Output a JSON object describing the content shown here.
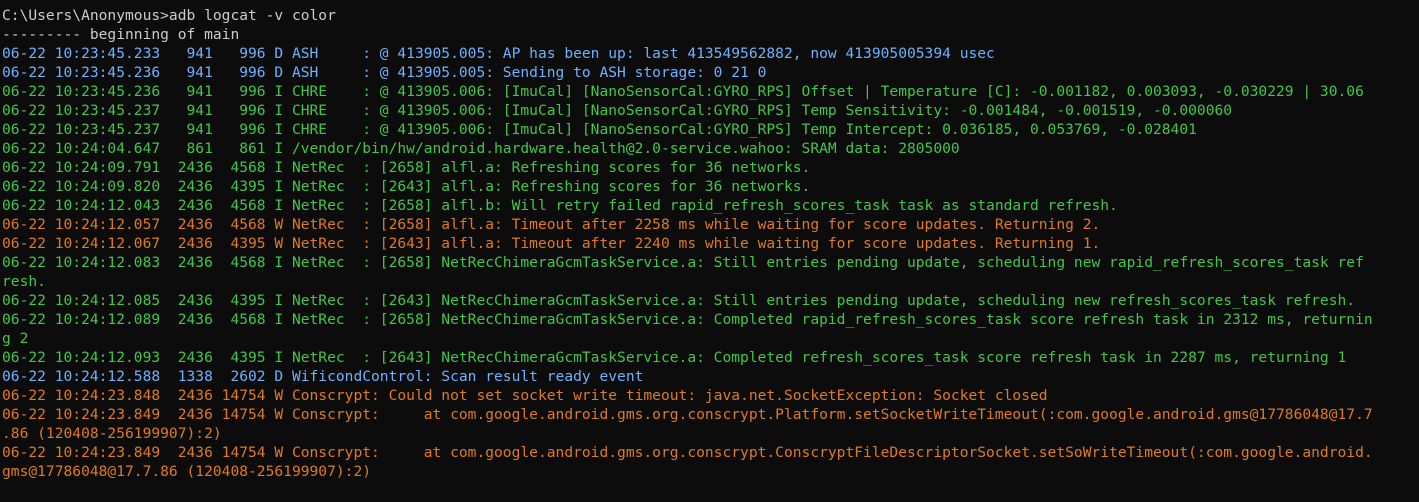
{
  "terminal": {
    "colors": {
      "background": "#0c0c0c",
      "default": "#cccccc",
      "debug": "#6fb1ff",
      "info": "#41c748",
      "warn": "#e07a1f"
    },
    "lines": [
      {
        "level": "default",
        "text": "C:\\Users\\Anonymous>adb logcat -v color"
      },
      {
        "level": "default",
        "text": "--------- beginning of main"
      },
      {
        "level": "D",
        "text": "06-22 10:23:45.233   941   996 D ASH     : @ 413905.005: AP has been up: last 413549562882, now 413905005394 usec"
      },
      {
        "level": "D",
        "text": "06-22 10:23:45.236   941   996 D ASH     : @ 413905.005: Sending to ASH storage: 0 21 0"
      },
      {
        "level": "I",
        "text": "06-22 10:23:45.236   941   996 I CHRE    : @ 413905.006: [ImuCal] [NanoSensorCal:GYRO_RPS] Offset | Temperature [C]: -0.001182, 0.003093, -0.030229 | 30.06"
      },
      {
        "level": "I",
        "text": "06-22 10:23:45.237   941   996 I CHRE    : @ 413905.006: [ImuCal] [NanoSensorCal:GYRO_RPS] Temp Sensitivity: -0.001484, -0.001519, -0.000060"
      },
      {
        "level": "I",
        "text": "06-22 10:23:45.237   941   996 I CHRE    : @ 413905.006: [ImuCal] [NanoSensorCal:GYRO_RPS] Temp Intercept: 0.036185, 0.053769, -0.028401"
      },
      {
        "level": "I",
        "text": "06-22 10:24:04.647   861   861 I /vendor/bin/hw/android.hardware.health@2.0-service.wahoo: SRAM data: 2805000"
      },
      {
        "level": "I",
        "text": "06-22 10:24:09.791  2436  4568 I NetRec  : [2658] alfl.a: Refreshing scores for 36 networks."
      },
      {
        "level": "I",
        "text": "06-22 10:24:09.820  2436  4395 I NetRec  : [2643] alfl.a: Refreshing scores for 36 networks."
      },
      {
        "level": "I",
        "text": "06-22 10:24:12.043  2436  4568 I NetRec  : [2658] alfl.b: Will retry failed rapid_refresh_scores_task task as standard refresh."
      },
      {
        "level": "W",
        "text": "06-22 10:24:12.057  2436  4568 W NetRec  : [2658] alfl.a: Timeout after 2258 ms while waiting for score updates. Returning 2."
      },
      {
        "level": "W",
        "text": "06-22 10:24:12.067  2436  4395 W NetRec  : [2643] alfl.a: Timeout after 2240 ms while waiting for score updates. Returning 1."
      },
      {
        "level": "I",
        "text": "06-22 10:24:12.083  2436  4568 I NetRec  : [2658] NetRecChimeraGcmTaskService.a: Still entries pending update, scheduling new rapid_refresh_scores_task ref"
      },
      {
        "level": "I",
        "text": "resh."
      },
      {
        "level": "I",
        "text": "06-22 10:24:12.085  2436  4395 I NetRec  : [2643] NetRecChimeraGcmTaskService.a: Still entries pending update, scheduling new refresh_scores_task refresh."
      },
      {
        "level": "I",
        "text": "06-22 10:24:12.089  2436  4568 I NetRec  : [2658] NetRecChimeraGcmTaskService.a: Completed rapid_refresh_scores_task score refresh task in 2312 ms, returnin"
      },
      {
        "level": "I",
        "text": "g 2"
      },
      {
        "level": "I",
        "text": "06-22 10:24:12.093  2436  4395 I NetRec  : [2643] NetRecChimeraGcmTaskService.a: Completed refresh_scores_task score refresh task in 2287 ms, returning 1"
      },
      {
        "level": "D",
        "text": "06-22 10:24:12.588  1338  2602 D WificondControl: Scan result ready event"
      },
      {
        "level": "W",
        "text": "06-22 10:24:23.848  2436 14754 W Conscrypt: Could not set socket write timeout: java.net.SocketException: Socket closed"
      },
      {
        "level": "W",
        "text": "06-22 10:24:23.849  2436 14754 W Conscrypt:     at com.google.android.gms.org.conscrypt.Platform.setSocketWriteTimeout(:com.google.android.gms@17786048@17.7"
      },
      {
        "level": "W",
        "text": ".86 (120408-256199907):2)"
      },
      {
        "level": "W",
        "text": "06-22 10:24:23.849  2436 14754 W Conscrypt:     at com.google.android.gms.org.conscrypt.ConscryptFileDescriptorSocket.setSoWriteTimeout(:com.google.android."
      },
      {
        "level": "W",
        "text": "gms@17786048@17.7.86 (120408-256199907):2)"
      }
    ]
  }
}
